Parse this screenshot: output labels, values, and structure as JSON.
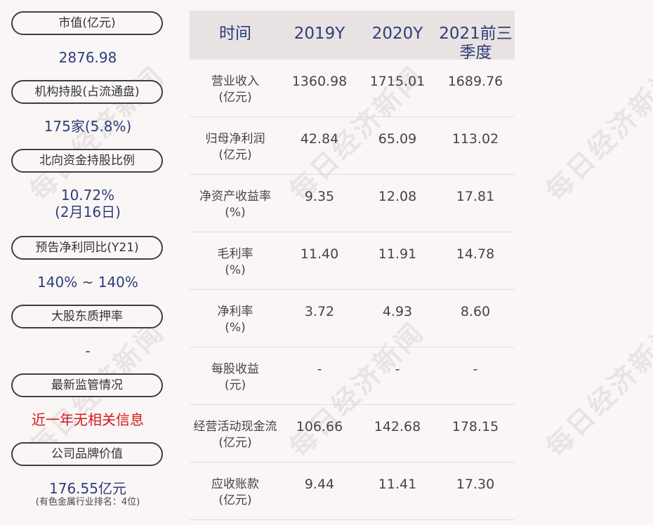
{
  "metrics": [
    {
      "label": "市值(亿元)",
      "value": "2876.98"
    },
    {
      "label": "机构持股(占流通盘)",
      "value": "175家(5.8%)"
    },
    {
      "label": "北向资金持股比例",
      "value": "10.72%",
      "value2": "(2月16日)"
    },
    {
      "label": "预告净利同比(Y21)",
      "value": "140% ~ 140%"
    },
    {
      "label": "大股东质押率",
      "value": "-"
    },
    {
      "label": "最新监管情况",
      "value": "近一年无相关信息"
    },
    {
      "label": "公司品牌价值",
      "value": "176.55亿元",
      "note": "(有色金属行业排名：4位)"
    }
  ],
  "table": {
    "headers": [
      "时间",
      "2019Y",
      "2020Y",
      "2021前三季度"
    ],
    "rows": [
      {
        "label1": "营业收入",
        "label2": "(亿元)",
        "values": [
          "1360.98",
          "1715.01",
          "1689.76"
        ]
      },
      {
        "label1": "归母净利润",
        "label2": "(亿元)",
        "values": [
          "42.84",
          "65.09",
          "113.02"
        ]
      },
      {
        "label1": "净资产收益率",
        "label2": "(%)",
        "values": [
          "9.35",
          "12.08",
          "17.81"
        ]
      },
      {
        "label1": "毛利率",
        "label2": "(%)",
        "values": [
          "11.40",
          "11.91",
          "14.78"
        ]
      },
      {
        "label1": "净利率",
        "label2": "(%)",
        "values": [
          "3.72",
          "4.93",
          "8.60"
        ]
      },
      {
        "label1": "每股收益",
        "label2": "(元)",
        "values": [
          "-",
          "-",
          "-"
        ]
      },
      {
        "label1": "经营活动现金流",
        "label2": "(亿元)",
        "values": [
          "106.66",
          "142.68",
          "178.15"
        ]
      },
      {
        "label1": "应收账款",
        "label2": "(亿元)",
        "values": [
          "9.44",
          "11.41",
          "17.30"
        ]
      }
    ]
  },
  "watermark": "每日经济新闻",
  "colors": {
    "value_blue": "#2c3e7a",
    "alert_red": "#d01a1a",
    "header_bg": "#e8e2e2"
  }
}
